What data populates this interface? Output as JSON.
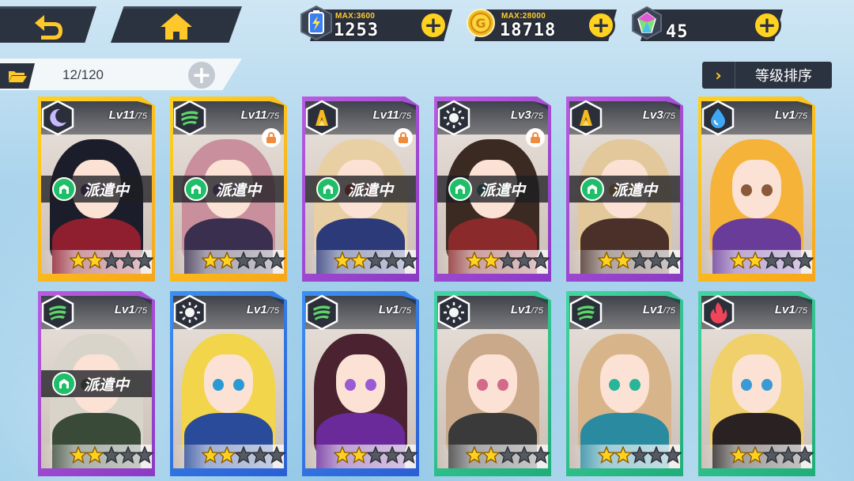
{
  "nav": {
    "back_icon": "back-arrow-icon",
    "home_icon": "home-icon"
  },
  "resources": [
    {
      "name": "stamina",
      "icon": "battery-energy-icon",
      "max_label": "MAX:3600",
      "value": "1253"
    },
    {
      "name": "gold",
      "icon": "gold-coin-icon",
      "max_label": "MAX:28000",
      "value": "18718"
    },
    {
      "name": "gem",
      "icon": "diamond-gem-icon",
      "max_label": "",
      "value": "45"
    }
  ],
  "inventory": {
    "count": "12/120",
    "add_icon": "plus-icon",
    "folder_icon": "folder-icon"
  },
  "sort": {
    "chevron": "›",
    "label": "等级排序"
  },
  "dispatch_label": "派遣中",
  "level_suffix": "/75",
  "colors": {
    "gold": "#ffc82a",
    "dark": "#2c3340",
    "green": "#1fbf6a",
    "orange": "#f08a3c"
  },
  "cards": [
    {
      "level": "Lv11",
      "element_icon": "moon-icon",
      "rarity": "gold",
      "dispatched": true,
      "locked": false,
      "stars": 2,
      "max_stars": 5,
      "hair": "#1c1d2a",
      "body": "#8f1e2e",
      "eyes": "#5a2b7a"
    },
    {
      "level": "Lv11",
      "element_icon": "wind-icon",
      "rarity": "gold",
      "dispatched": true,
      "locked": true,
      "stars": 2,
      "max_stars": 5,
      "hair": "#c98f9c",
      "body": "#3a2f4e",
      "eyes": "#7a4f9a"
    },
    {
      "level": "Lv11",
      "element_icon": "earth-icon",
      "rarity": "purple",
      "dispatched": true,
      "locked": true,
      "stars": 2,
      "max_stars": 5,
      "hair": "#e8cfa4",
      "body": "#2c3a7a",
      "eyes": "#c0392b"
    },
    {
      "level": "Lv3",
      "element_icon": "sun-icon",
      "rarity": "purple",
      "dispatched": true,
      "locked": true,
      "stars": 2,
      "max_stars": 5,
      "hair": "#3a2a22",
      "body": "#8a2a2a",
      "eyes": "#2a8a7a"
    },
    {
      "level": "Lv3",
      "element_icon": "earth-icon",
      "rarity": "purple",
      "dispatched": true,
      "locked": false,
      "stars": 2,
      "max_stars": 5,
      "hair": "#e2c89a",
      "body": "#4a3028",
      "eyes": "#d4a12a"
    },
    {
      "level": "Lv1",
      "element_icon": "water-icon",
      "rarity": "gold",
      "dispatched": false,
      "locked": false,
      "stars": 2,
      "max_stars": 5,
      "hair": "#f6b33a",
      "body": "#6a3c9a",
      "eyes": "#8a5a3a"
    },
    {
      "level": "Lv1",
      "element_icon": "wind-icon",
      "rarity": "purple",
      "dispatched": true,
      "locked": false,
      "stars": 2,
      "max_stars": 5,
      "hair": "#d8d4ca",
      "body": "#3a4a38",
      "eyes": "#5a7a4a"
    },
    {
      "level": "Lv1",
      "element_icon": "sun-icon",
      "rarity": "blue",
      "dispatched": false,
      "locked": false,
      "stars": 2,
      "max_stars": 5,
      "hair": "#f2d54a",
      "body": "#2a4a9a",
      "eyes": "#2a9ad4"
    },
    {
      "level": "Lv1",
      "element_icon": "wind-icon",
      "rarity": "blue",
      "dispatched": false,
      "locked": false,
      "stars": 2,
      "max_stars": 5,
      "hair": "#4a2230",
      "body": "#6a2a9a",
      "eyes": "#9a5ad4"
    },
    {
      "level": "Lv1",
      "element_icon": "sun-icon",
      "rarity": "green",
      "dispatched": false,
      "locked": false,
      "stars": 2,
      "max_stars": 5,
      "hair": "#c9a98a",
      "body": "#3a3a3a",
      "eyes": "#d46a8a"
    },
    {
      "level": "Lv1",
      "element_icon": "wind-icon",
      "rarity": "green",
      "dispatched": false,
      "locked": false,
      "stars": 2,
      "max_stars": 5,
      "hair": "#d8b48a",
      "body": "#2a8aa0",
      "eyes": "#2ab49a"
    },
    {
      "level": "Lv1",
      "element_icon": "fire-icon",
      "rarity": "green",
      "dispatched": false,
      "locked": false,
      "stars": 2,
      "max_stars": 5,
      "hair": "#f0d06a",
      "body": "#2a2222",
      "eyes": "#3a9ad4"
    }
  ]
}
